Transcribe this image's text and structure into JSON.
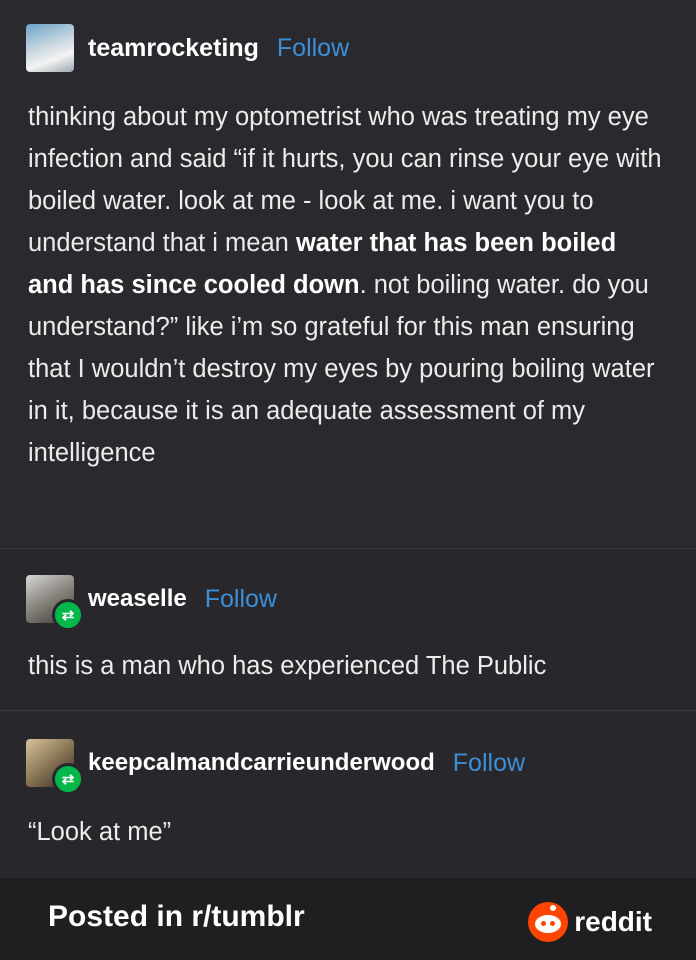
{
  "posts": [
    {
      "username": "teamrocketing",
      "follow": "Follow",
      "avatar_icon": "moomin-avatar-icon",
      "text_parts": [
        "thinking about my optometrist who was treating my eye infection and said “if it hurts, you can rinse your eye with boiled water. look at me - look at me. i want you to understand that i mean ",
        "water that has been boiled and has since cooled down",
        ". not boiling water. do you understand?” like i’m so grateful for this man ensuring that I wouldn’t destroy my eyes by pouring boiling water in it, because it is an adequate assessment of my intelligence"
      ]
    },
    {
      "username": "weaselle",
      "follow": "Follow",
      "avatar_icon": "weaselle-avatar-icon",
      "badge_icon": "reblog-icon",
      "text": "this is a man who has experienced The Public"
    },
    {
      "username": "keepcalmandcarrieunderwood",
      "follow": "Follow",
      "avatar_icon": "keepcalm-avatar-icon",
      "badge_icon": "reblog-icon",
      "text": "“Look at me”"
    }
  ],
  "footer": {
    "posted_in": "Posted in r/tumblr",
    "brand": "reddit",
    "brand_icon": "reddit-logo-icon",
    "brand_color": "#ff4500"
  },
  "colors": {
    "background": "#26262a",
    "follow_link": "#3d8fd8",
    "reblog_badge": "#00b84a"
  }
}
